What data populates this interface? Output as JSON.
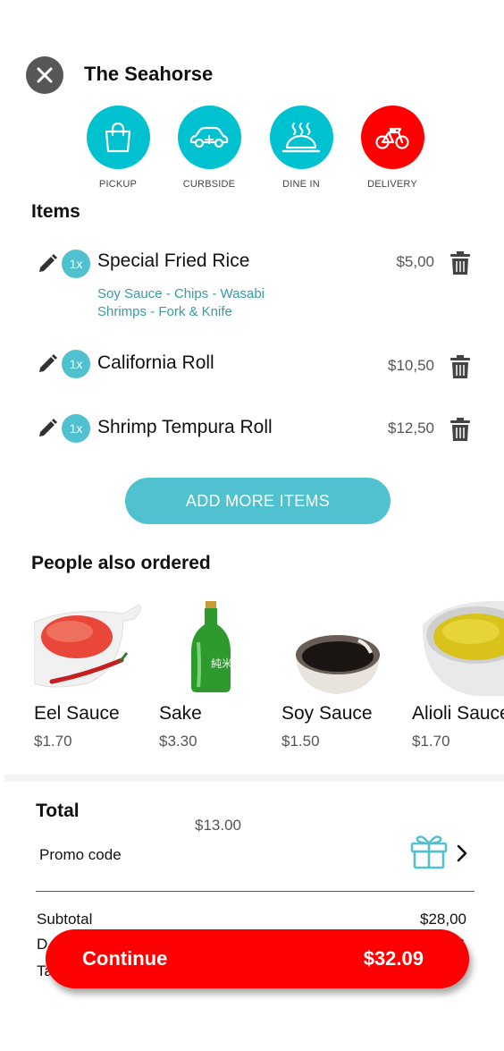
{
  "header": {
    "title": "The Seahorse",
    "close_icon": "close-icon"
  },
  "order_types": [
    {
      "label": "PICKUP",
      "icon": "shopping-bag-icon",
      "color": "#00c1d0"
    },
    {
      "label": "CURBSIDE",
      "icon": "car-icon",
      "color": "#00c1d0"
    },
    {
      "label": "DINE IN",
      "icon": "serving-dish-icon",
      "color": "#00c1d0"
    },
    {
      "label": "DELIVERY",
      "icon": "bicycle-icon",
      "color": "#ff0000",
      "selected": true
    }
  ],
  "items_section": {
    "title": "Items",
    "items": [
      {
        "qty": "1x",
        "name": "Special Fried Rice",
        "price": "$5,00",
        "modifiers": [
          "Soy Sauce - Chips - Wasabi",
          "Shrimps - Fork & Knife"
        ]
      },
      {
        "qty": "1x",
        "name": "California Roll",
        "price": "$10,50"
      },
      {
        "qty": "1x",
        "name": "Shrimp Tempura Roll",
        "price": "$12,50"
      }
    ],
    "add_more_label": "ADD MORE ITEMS"
  },
  "suggestions": {
    "title": "People also ordered",
    "items": [
      {
        "name": "Eel Sauce",
        "price": "$1.70"
      },
      {
        "name": "Sake",
        "price": "$3.30"
      },
      {
        "name": "Soy Sauce",
        "price": "$1.50"
      },
      {
        "name": "Alioli Sauce",
        "price": "$1.70"
      }
    ]
  },
  "totals": {
    "title": "Total",
    "amount": "$13.00",
    "promo_label": "Promo code",
    "subtotal_label": "Subtotal",
    "subtotal_value": "$28,00",
    "partial_label_1": "D",
    "partial_label_2": "Ta",
    "partial_value": "$"
  },
  "continue_button": {
    "label": "Continue",
    "total": "$32.09"
  },
  "colors": {
    "accent": "#4fc1cf",
    "icon_teal": "#00c1d0",
    "brand_red": "#ff0000",
    "modifier_text": "#3a9aa3"
  }
}
